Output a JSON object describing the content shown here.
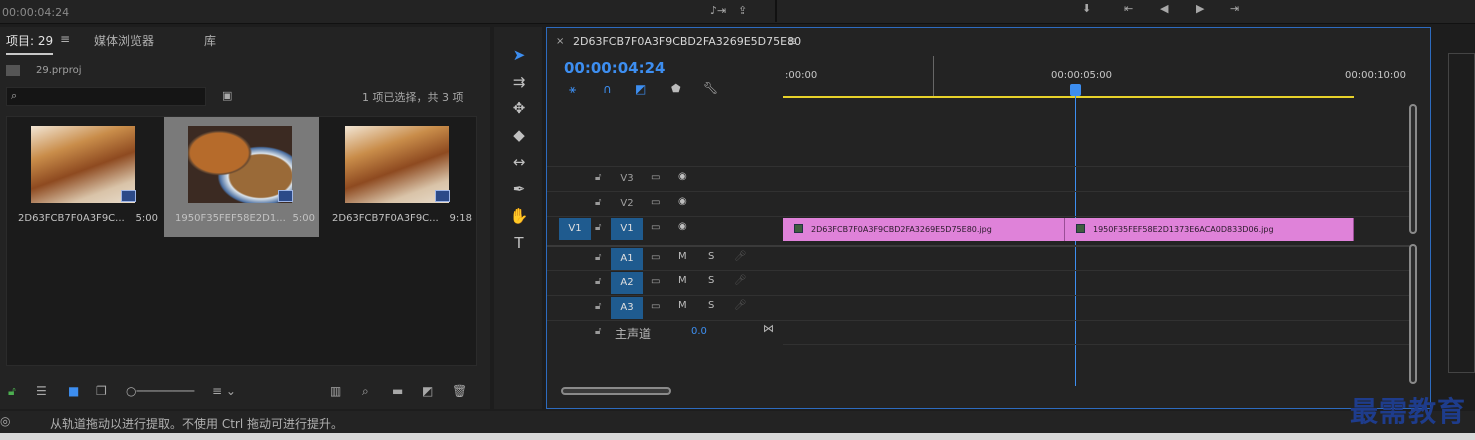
{
  "top": {
    "timecode": "00:00:04:24"
  },
  "project": {
    "tabs": [
      {
        "label": "项目: 29"
      },
      {
        "label": "媒体浏览器"
      },
      {
        "label": "库"
      }
    ],
    "file": "29.prproj",
    "selection_status": "1 项已选择，共 3 项",
    "items": [
      {
        "name": "2D63FCB7F0A3F9C...",
        "duration": "5:00"
      },
      {
        "name": "1950F35FEF58E2D1...",
        "duration": "5:00"
      },
      {
        "name": "2D63FCB7F0A3F9C...",
        "duration": "9:18"
      }
    ]
  },
  "timeline": {
    "sequence": "2D63FCB7F0A3F9CBD2FA3269E5D75E80",
    "timecode": "00:00:04:24",
    "ruler": [
      ":00:00",
      "00:00:05:00",
      "00:00:10:00"
    ],
    "tracks": [
      {
        "name": "V3",
        "source": "",
        "c2": "",
        "c3": ""
      },
      {
        "name": "V2",
        "source": "",
        "c2": "",
        "c3": ""
      },
      {
        "name": "V1",
        "source": "V1",
        "c2": "",
        "c3": ""
      },
      {
        "name": "A1",
        "source": "",
        "c2": "M",
        "c3": "S"
      },
      {
        "name": "A2",
        "source": "",
        "c2": "M",
        "c3": "S"
      },
      {
        "name": "A3",
        "source": "",
        "c2": "M",
        "c3": "S"
      }
    ],
    "master": {
      "label": "主声道",
      "value": "0.0"
    },
    "clips": [
      {
        "name": "2D63FCB7F0A3F9CBD2FA3269E5D75E80.jpg"
      },
      {
        "name": "1950F35FEF58E2D1373E6ACA0D833D06.jpg"
      }
    ]
  },
  "status": {
    "text": "从轨道拖动以进行提取。不使用 Ctrl 拖动可进行提升。"
  },
  "watermark": "最需教育",
  "colors": {
    "accent": "#2d6bbf",
    "playhead": "#3d8ef0",
    "clip": "#df82d9",
    "workarea": "#e8d22a"
  }
}
